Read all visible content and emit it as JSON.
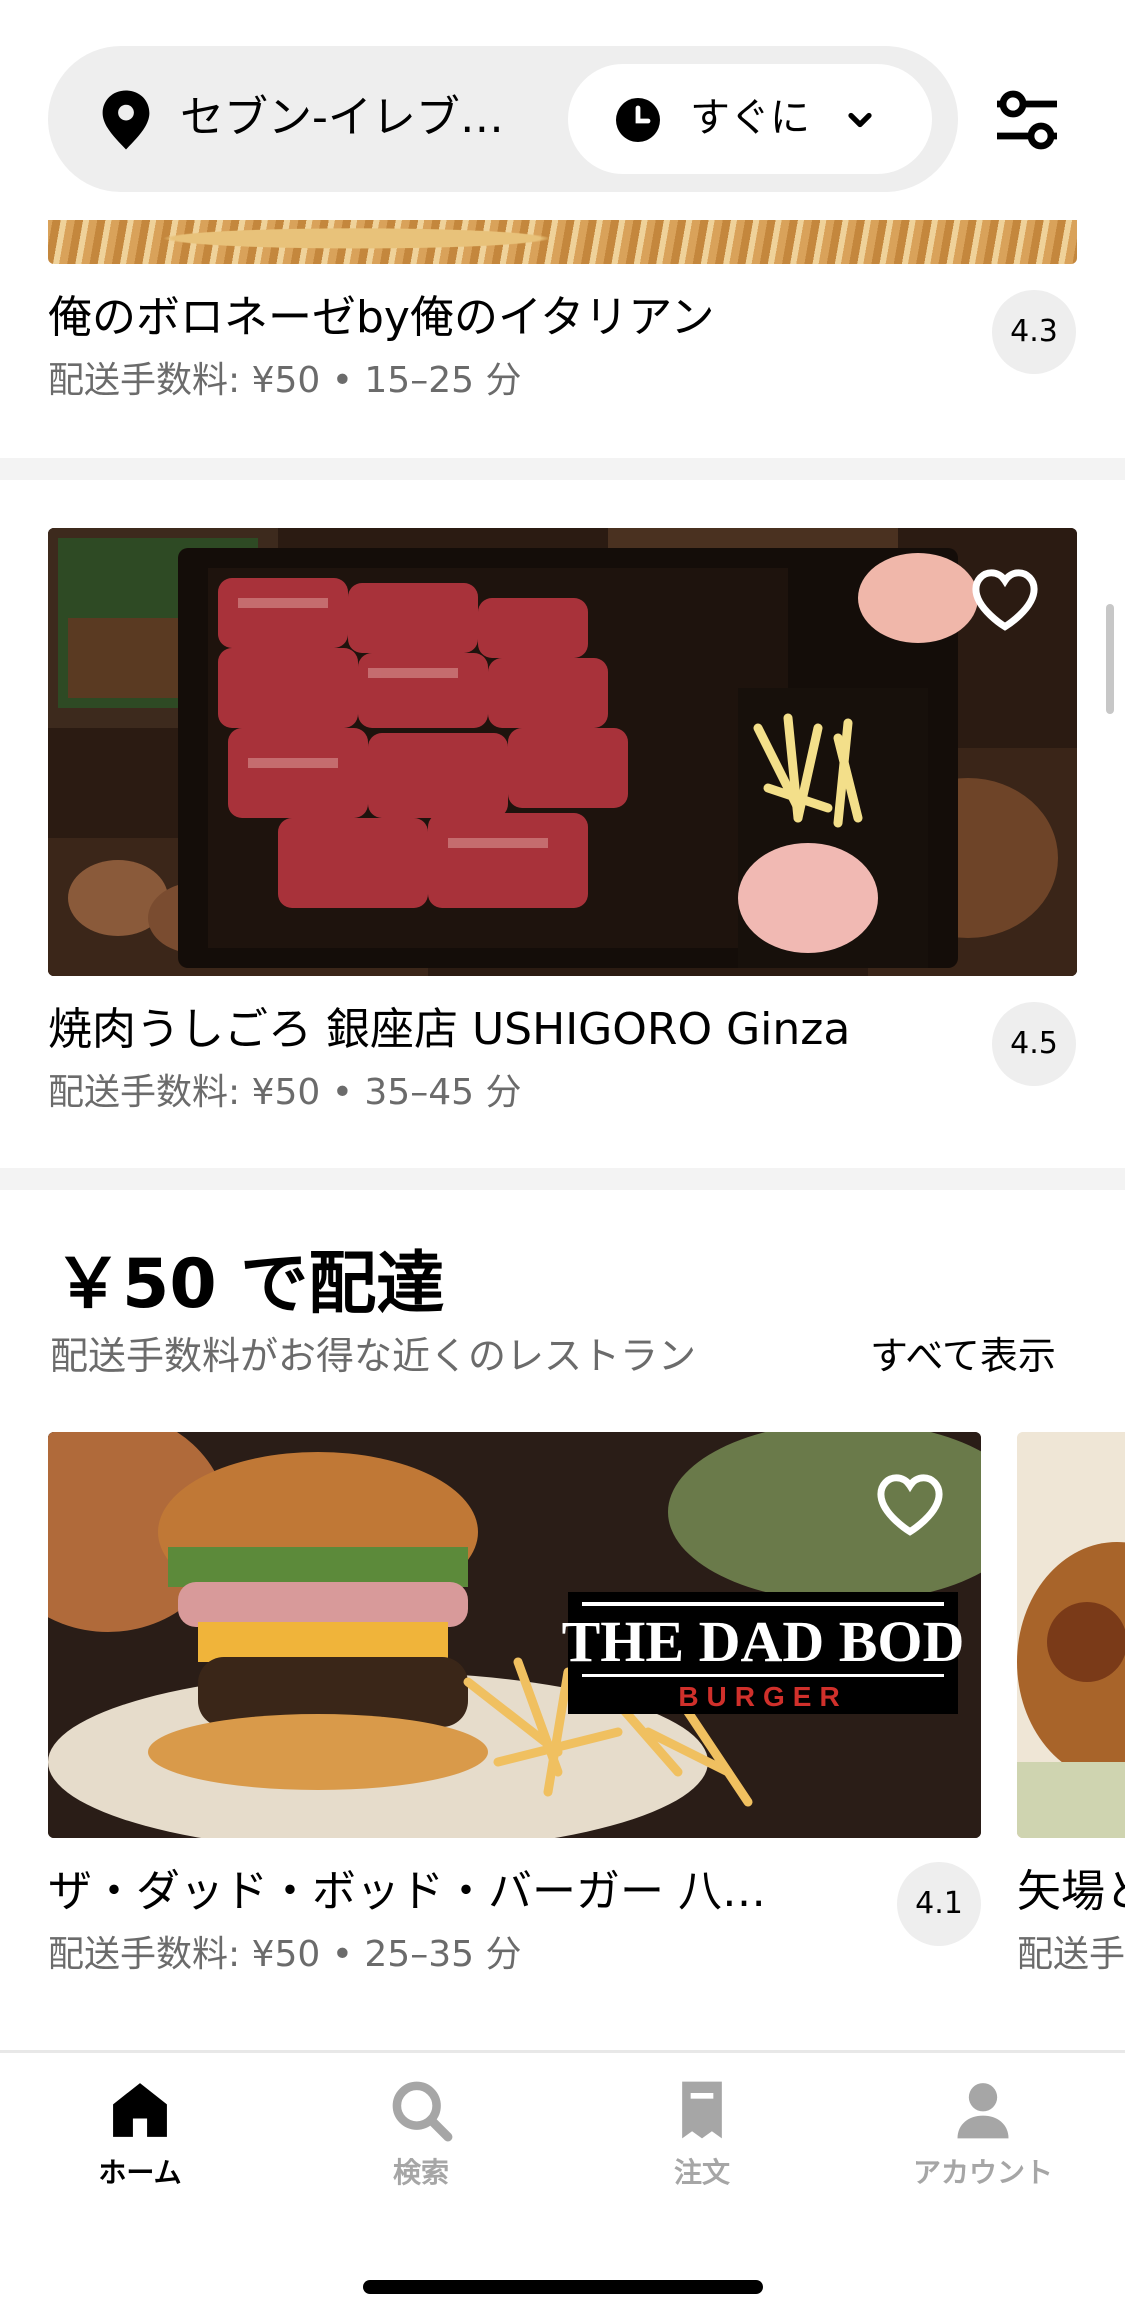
{
  "header": {
    "location_label": "セブン-イレブ…",
    "time_label": "すぐに"
  },
  "stores": [
    {
      "name": "俺のボロネーゼby俺のイタリアン",
      "meta": "配送手数料: ¥50 • 15–25 分",
      "rating": "4.3"
    },
    {
      "name": "焼肉うしごろ 銀座店 USHIGORO Ginza",
      "meta": "配送手数料: ¥50 • 35–45 分",
      "rating": "4.5"
    }
  ],
  "section": {
    "title": "￥50 で配達",
    "subtitle": "配送手数料がお得な近くのレストラン",
    "see_all": "すべて表示",
    "cards": [
      {
        "name": "ザ・ダッド・ボッド・バーガー 八…",
        "meta": "配送手数料: ¥50 • 25–35 分",
        "rating": "4.1",
        "logo_line1": "THE DAD BOD",
        "logo_line2": "BURGER"
      },
      {
        "name": "矢場とん",
        "meta": "配送手数料"
      }
    ]
  },
  "nav": {
    "items": [
      {
        "label": "ホーム",
        "icon": "home-icon",
        "active": true
      },
      {
        "label": "検索",
        "icon": "search-icon",
        "active": false
      },
      {
        "label": "注文",
        "icon": "receipt-icon",
        "active": false
      },
      {
        "label": "アカウント",
        "icon": "account-icon",
        "active": false
      }
    ]
  },
  "colors": {
    "pill_bg": "#eeeeee",
    "muted_text": "#6b6b6b",
    "inactive_nav": "#a6a6a6",
    "logo_red": "#d0302b"
  }
}
